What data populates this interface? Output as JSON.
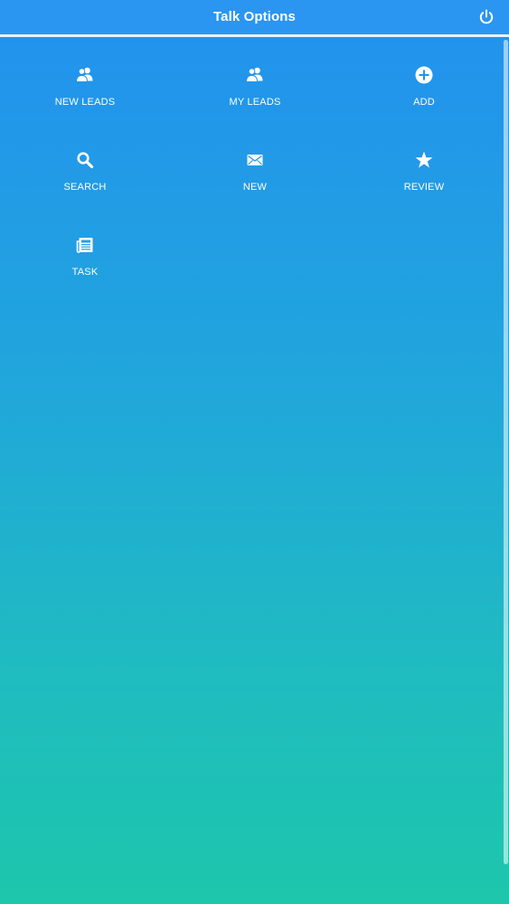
{
  "header": {
    "title": "Talk Options",
    "power_icon": "power-icon"
  },
  "menu": {
    "items": [
      {
        "label": "NEW LEADS",
        "icon": "users-icon"
      },
      {
        "label": "MY LEADS",
        "icon": "users-icon"
      },
      {
        "label": "ADD",
        "icon": "plus-circle-icon"
      },
      {
        "label": "SEARCH",
        "icon": "search-icon"
      },
      {
        "label": "NEW",
        "icon": "mail-icon"
      },
      {
        "label": "REVIEW",
        "icon": "star-icon"
      },
      {
        "label": "TASK",
        "icon": "newspaper-icon"
      }
    ]
  },
  "colors": {
    "header": "#2b95f2",
    "gradient_top": "#2291ef",
    "gradient_bottom": "#1ec6ab",
    "text": "#ffffff"
  }
}
